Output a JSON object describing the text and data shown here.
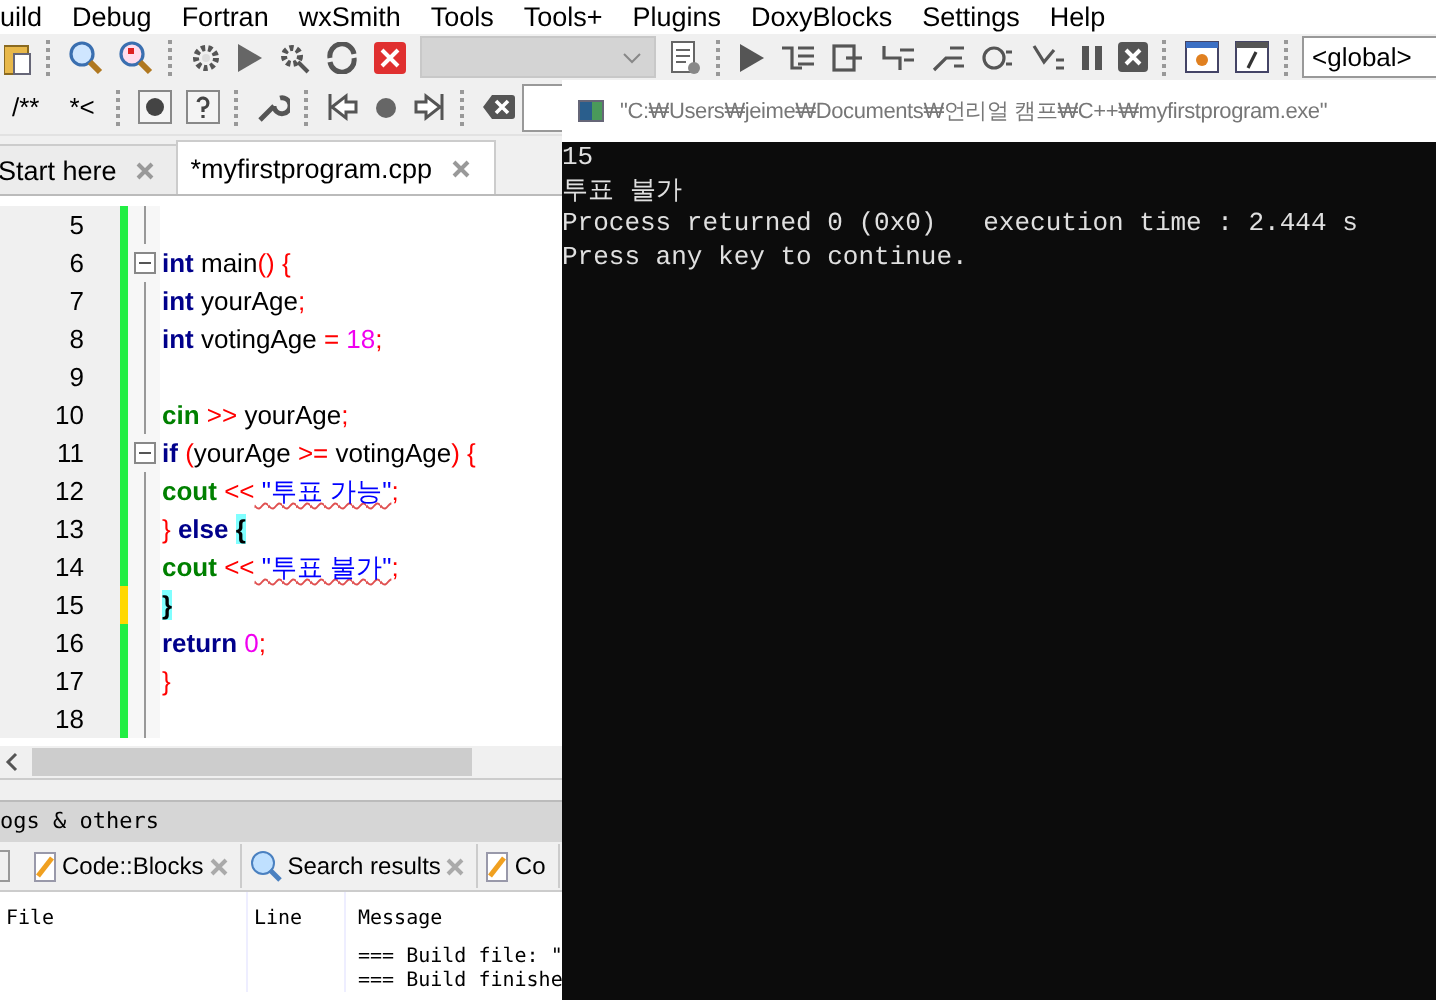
{
  "menu": [
    "uild",
    "Debug",
    "Fortran",
    "wxSmith",
    "Tools",
    "Tools+",
    "Plugins",
    "DoxyBlocks",
    "Settings",
    "Help"
  ],
  "toolbar": {
    "scope_dropdown": "<global>",
    "comment_buttons": [
      "/**",
      "*<"
    ]
  },
  "editor_tabs": [
    {
      "label": "Start here",
      "selected": false
    },
    {
      "label": "*myfirstprogram.cpp",
      "selected": true
    }
  ],
  "code_lines": [
    {
      "number": "5",
      "modified": false,
      "fold": false
    },
    {
      "number": "6",
      "modified": false,
      "fold": true,
      "tokens": [
        {
          "kind": "keyword",
          "text": "int"
        },
        {
          "kind": "ident",
          "text": " main"
        },
        {
          "kind": "op",
          "text": "()"
        },
        {
          "kind": "op",
          "text": " {"
        }
      ]
    },
    {
      "number": "7",
      "modified": false,
      "fold": false,
      "tokens": [
        {
          "kind": "keyword",
          "text": "int"
        },
        {
          "kind": "ident",
          "text": " yourAge"
        },
        {
          "kind": "op",
          "text": ";"
        }
      ]
    },
    {
      "number": "8",
      "modified": false,
      "fold": false,
      "tokens": [
        {
          "kind": "keyword",
          "text": "int"
        },
        {
          "kind": "ident",
          "text": " votingAge "
        },
        {
          "kind": "op",
          "text": "="
        },
        {
          "kind": "number",
          "text": " 18"
        },
        {
          "kind": "op",
          "text": ";"
        }
      ]
    },
    {
      "number": "9",
      "modified": false,
      "fold": false
    },
    {
      "number": "10",
      "modified": false,
      "fold": false,
      "tokens": [
        {
          "kind": "stream",
          "text": "cin"
        },
        {
          "kind": "op",
          "text": " >>"
        },
        {
          "kind": "ident",
          "text": " yourAge"
        },
        {
          "kind": "op",
          "text": ";"
        }
      ]
    },
    {
      "number": "11",
      "modified": false,
      "fold": true,
      "tokens": [
        {
          "kind": "keyword",
          "text": "if"
        },
        {
          "kind": "op",
          "text": " ("
        },
        {
          "kind": "ident",
          "text": "yourAge "
        },
        {
          "kind": "op",
          "text": ">="
        },
        {
          "kind": "ident",
          "text": " votingAge"
        },
        {
          "kind": "op",
          "text": ")"
        },
        {
          "kind": "op",
          "text": " {"
        }
      ]
    },
    {
      "number": "12",
      "modified": false,
      "fold": false,
      "tokens": [
        {
          "kind": "stream",
          "text": "cout"
        },
        {
          "kind": "op",
          "text": " <<"
        },
        {
          "kind": "string",
          "text": " \"투표 가능\""
        },
        {
          "kind": "op",
          "text": ";"
        }
      ]
    },
    {
      "number": "13",
      "modified": false,
      "fold": false,
      "tokens": [
        {
          "kind": "op",
          "text": "}"
        },
        {
          "kind": "keyword",
          "text": " else "
        },
        {
          "kind": "brace_match",
          "text": "{"
        }
      ]
    },
    {
      "number": "14",
      "modified": false,
      "fold": false,
      "tokens": [
        {
          "kind": "stream",
          "text": "cout"
        },
        {
          "kind": "op",
          "text": " <<"
        },
        {
          "kind": "string",
          "text": " \"투표 불가\""
        },
        {
          "kind": "op",
          "text": ";"
        }
      ]
    },
    {
      "number": "15",
      "modified": true,
      "fold": false,
      "tokens": [
        {
          "kind": "brace_match",
          "text": "}"
        }
      ]
    },
    {
      "number": "16",
      "modified": false,
      "fold": false,
      "tokens": [
        {
          "kind": "keyword",
          "text": "return"
        },
        {
          "kind": "number",
          "text": " 0"
        },
        {
          "kind": "op",
          "text": ";"
        }
      ]
    },
    {
      "number": "17",
      "modified": false,
      "fold": false,
      "tokens": [
        {
          "kind": "op",
          "text": "}"
        }
      ]
    },
    {
      "number": "18",
      "modified": false,
      "fold": false
    }
  ],
  "logs_panel": {
    "title": "ogs & others",
    "tabs": [
      {
        "label": "Code::Blocks",
        "kind": "pencil"
      },
      {
        "label": "Search results",
        "kind": "search"
      },
      {
        "label": "Co",
        "kind": "pencil"
      }
    ],
    "columns": [
      "File",
      "Line",
      "Message"
    ],
    "rows": [
      {
        "message": "=== Build file: \""
      },
      {
        "message": "=== Build finishe"
      }
    ]
  },
  "console": {
    "title": "\"C:₩Users₩jeime₩Documents₩언리얼 캠프₩C++₩myfirstprogram.exe\"",
    "lines": [
      "15",
      "투표 불가",
      "Process returned 0 (0x0)   execution time : 2.444 s",
      "Press any key to continue."
    ]
  }
}
